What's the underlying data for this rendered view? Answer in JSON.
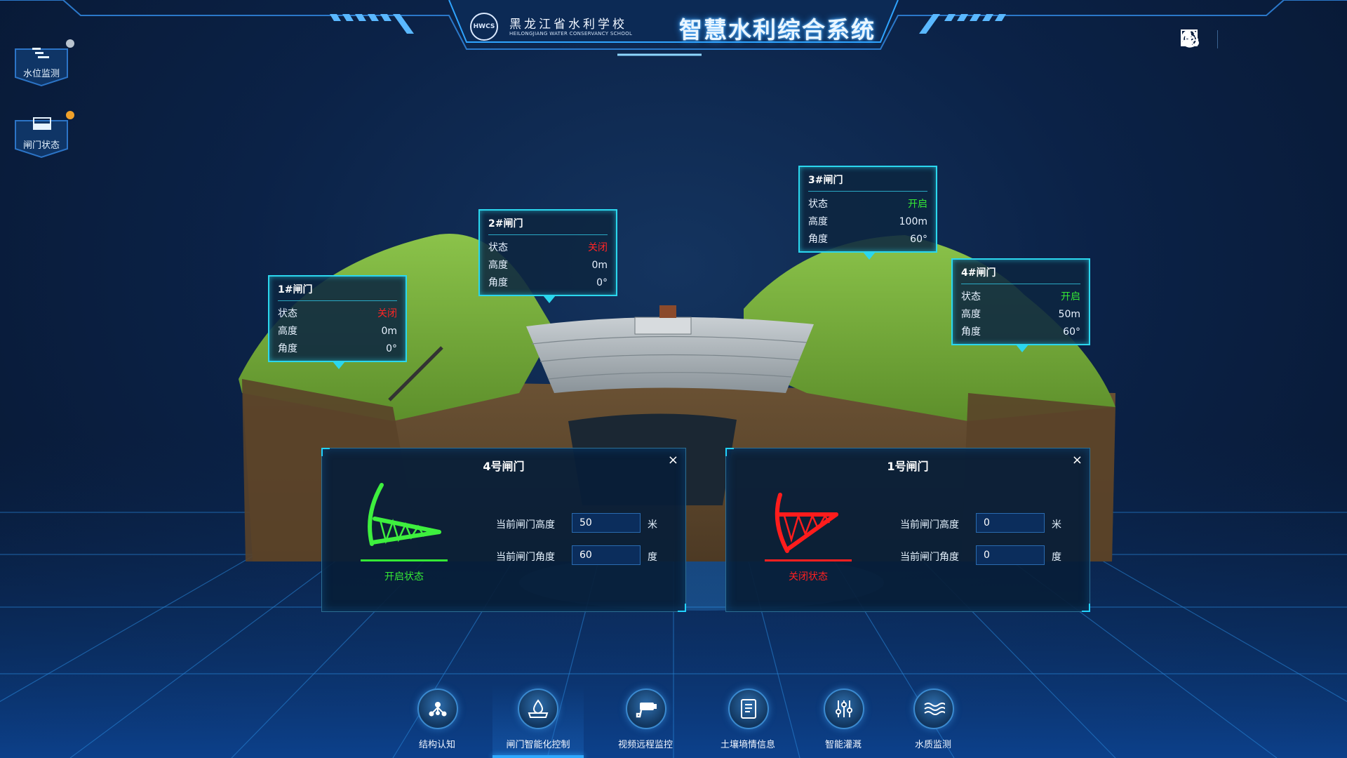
{
  "header": {
    "school_cn": "黑龙江省水利学校",
    "school_en": "HEILONGJIANG WATER CONSERVANCY SCHOOL",
    "logo_text": "HWCS",
    "title": "智慧水利综合系统",
    "icons": [
      "refresh-eye-icon",
      "user-settings-icon",
      "minimize-icon",
      "power-icon"
    ]
  },
  "left_nav": [
    {
      "label": "水位监测",
      "dot_color": "#b9c4cf"
    },
    {
      "label": "闸门状态",
      "dot_color": "#f0a12a"
    }
  ],
  "gate_labels": [
    {
      "title": "1#闸门",
      "status_label": "状态",
      "status": "关闭",
      "status_color": "red",
      "height_label": "高度",
      "height": "0m",
      "angle_label": "角度",
      "angle": "0°"
    },
    {
      "title": "2#闸门",
      "status_label": "状态",
      "status": "关闭",
      "status_color": "red",
      "height_label": "高度",
      "height": "0m",
      "angle_label": "角度",
      "angle": "0°"
    },
    {
      "title": "3#闸门",
      "status_label": "状态",
      "status": "开启",
      "status_color": "green",
      "height_label": "高度",
      "height": "100m",
      "angle_label": "角度",
      "angle": "60°"
    },
    {
      "title": "4#闸门",
      "status_label": "状态",
      "status": "开启",
      "status_color": "green",
      "height_label": "高度",
      "height": "50m",
      "angle_label": "角度",
      "angle": "60°"
    }
  ],
  "panels": [
    {
      "title": "4号闸门",
      "close": "×",
      "state": "开启状态",
      "state_color": "#35e835",
      "height_label": "当前闸门高度",
      "height_value": "50",
      "height_unit": "米",
      "angle_label": "当前闸门角度",
      "angle_value": "60",
      "angle_unit": "度"
    },
    {
      "title": "1号闸门",
      "close": "×",
      "state": "关闭状态",
      "state_color": "#ff2020",
      "height_label": "当前闸门高度",
      "height_value": "0",
      "height_unit": "米",
      "angle_label": "当前闸门角度",
      "angle_value": "0",
      "angle_unit": "度"
    }
  ],
  "bottom_nav": [
    {
      "label": "结构认知",
      "icon": "structure-icon",
      "active": false
    },
    {
      "label": "闸门智能化控制",
      "icon": "gate-control-icon",
      "active": true
    },
    {
      "label": "视频远程监控",
      "icon": "camera-icon",
      "active": false
    },
    {
      "label": "土壤墒情信息",
      "icon": "document-icon",
      "active": false
    },
    {
      "label": "智能灌溉",
      "icon": "sliders-icon",
      "active": false
    },
    {
      "label": "水质监测",
      "icon": "water-waves-icon",
      "active": false
    }
  ]
}
